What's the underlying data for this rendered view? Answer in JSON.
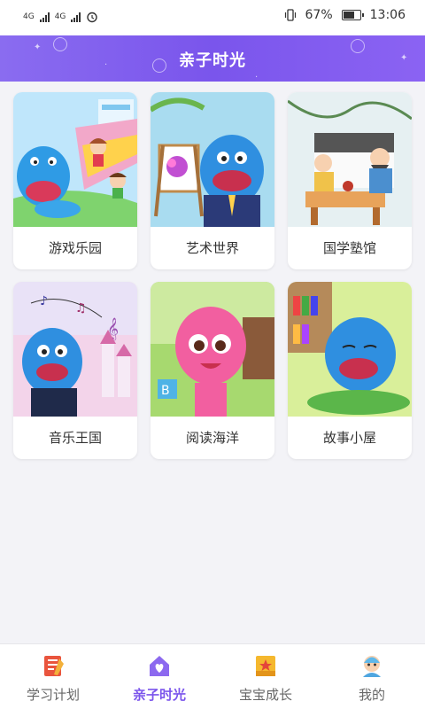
{
  "status_bar": {
    "network_1": "4G",
    "network_2": "4G",
    "battery": "67%",
    "battery_level": 0.67,
    "time": "13:06"
  },
  "header": {
    "title": "亲子时光"
  },
  "cards": [
    {
      "label": "游戏乐园",
      "icon": "playground-illustration"
    },
    {
      "label": "艺术世界",
      "icon": "art-easel-illustration"
    },
    {
      "label": "国学塾馆",
      "icon": "classical-study-illustration"
    },
    {
      "label": "音乐王国",
      "icon": "music-castle-illustration"
    },
    {
      "label": "阅读海洋",
      "icon": "reading-character-illustration"
    },
    {
      "label": "故事小屋",
      "icon": "story-house-illustration"
    }
  ],
  "bottom_nav": [
    {
      "label": "学习计划",
      "icon": "notebook-icon",
      "active": false
    },
    {
      "label": "亲子时光",
      "icon": "home-heart-icon",
      "active": true
    },
    {
      "label": "宝宝成长",
      "icon": "star-book-icon",
      "active": false
    },
    {
      "label": "我的",
      "icon": "profile-avatar-icon",
      "active": false
    }
  ],
  "colors": {
    "accent": "#7b55ec",
    "header_start": "#8a6cf0",
    "background": "#f3f3f7"
  }
}
